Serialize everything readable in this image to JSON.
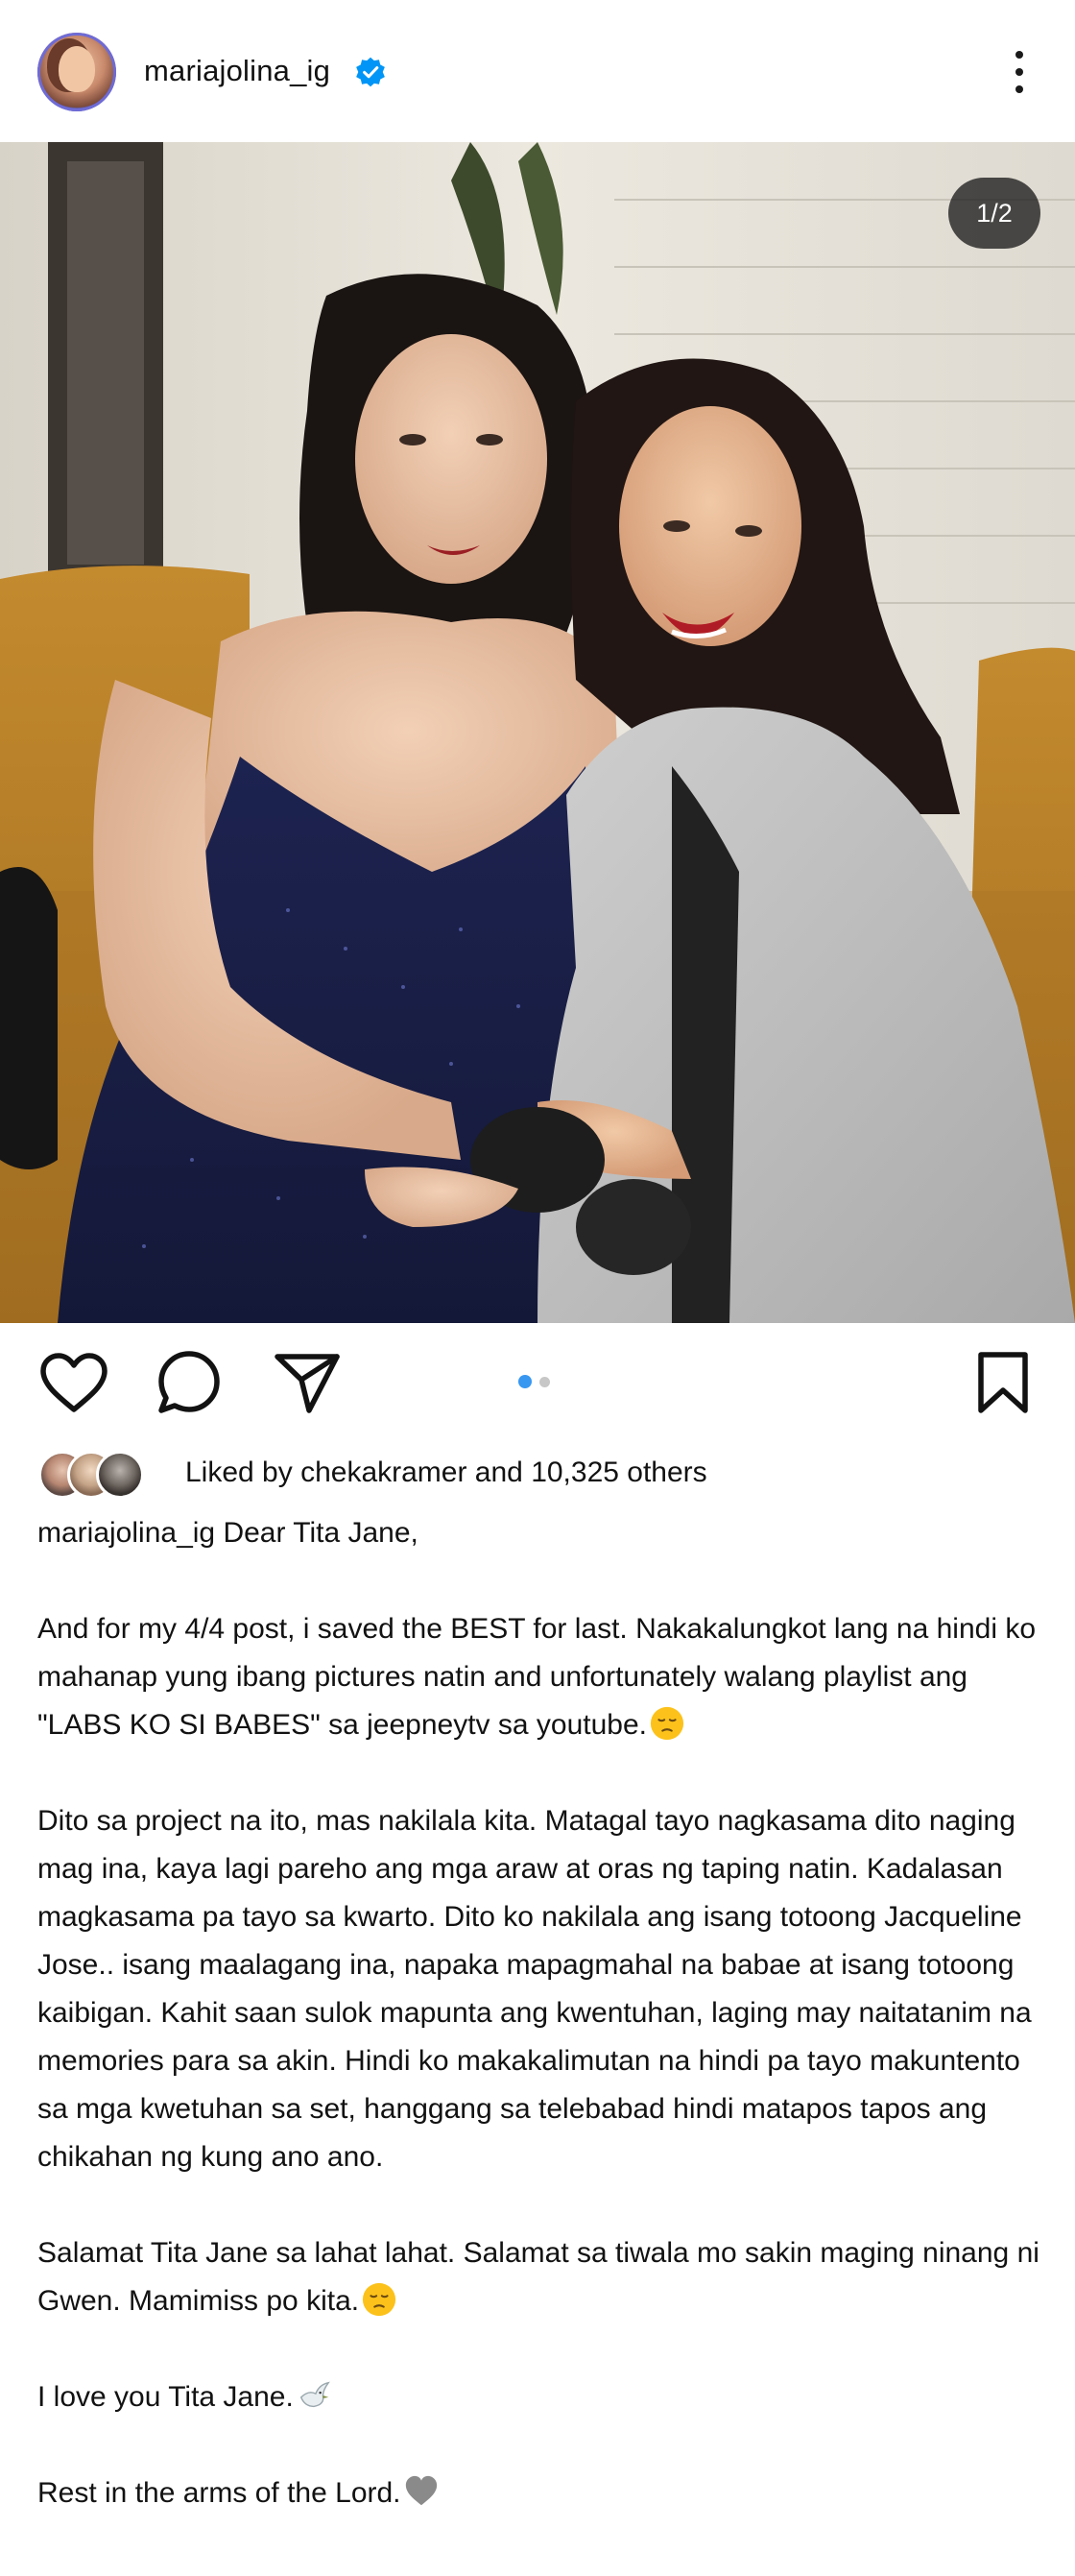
{
  "header": {
    "username": "mariajolina_ig",
    "verified_icon": "verified-badge-icon",
    "more_icon": "more-options-icon",
    "avatar_icon": "profile-avatar"
  },
  "media": {
    "page_indicator": "1/2",
    "carousel_total": 2,
    "carousel_active": 1
  },
  "actions": {
    "like_icon": "heart-icon",
    "comment_icon": "comment-icon",
    "share_icon": "send-icon",
    "save_icon": "bookmark-icon"
  },
  "likes": {
    "text": "Liked by chekakramer and 10,325 others"
  },
  "caption": {
    "author": "mariajolina_ig",
    "opening": "Dear Tita Jane,",
    "paragraph1": "And for my 4/4 post, i saved the BEST for last. Nakakalungkot lang na hindi ko mahanap yung ibang pictures natin and unfortunately walang playlist ang \"LABS KO SI BABES\" sa jeepneytv sa youtube.",
    "paragraph2": "Dito sa project na ito, mas nakilala kita. Matagal tayo nagkasama dito naging mag ina, kaya lagi pareho ang mga araw at oras ng taping natin. Kadalasan magkasama pa tayo sa kwarto. Dito ko nakilala ang isang totoong Jacqueline Jose.. isang maalagang ina, napaka mapagmahal na babae at isang totoong kaibigan. Kahit saan sulok mapunta ang kwentuhan, laging may naitatanim na memories para sa akin. Hindi ko makakalimutan na hindi pa tayo makuntento sa mga kwetuhan sa set, hanggang sa telebabad hindi matapos tapos ang chikahan ng kung ano ano.",
    "paragraph3": "Salamat Tita Jane sa lahat lahat. Salamat sa tiwala mo sakin maging ninang ni Gwen. Mamimiss po kita.",
    "paragraph4": "I love you Tita Jane.",
    "paragraph5": "Rest in the arms of the Lord.",
    "emoji_pensive": "pensive-face-emoji",
    "emoji_dove": "dove-emoji",
    "emoji_heart": "grey-heart-emoji"
  },
  "colors": {
    "accent_blue": "#3897f0",
    "verified_blue": "#0095f6",
    "text": "#121212",
    "indicator_bg": "#1c1c1c"
  }
}
